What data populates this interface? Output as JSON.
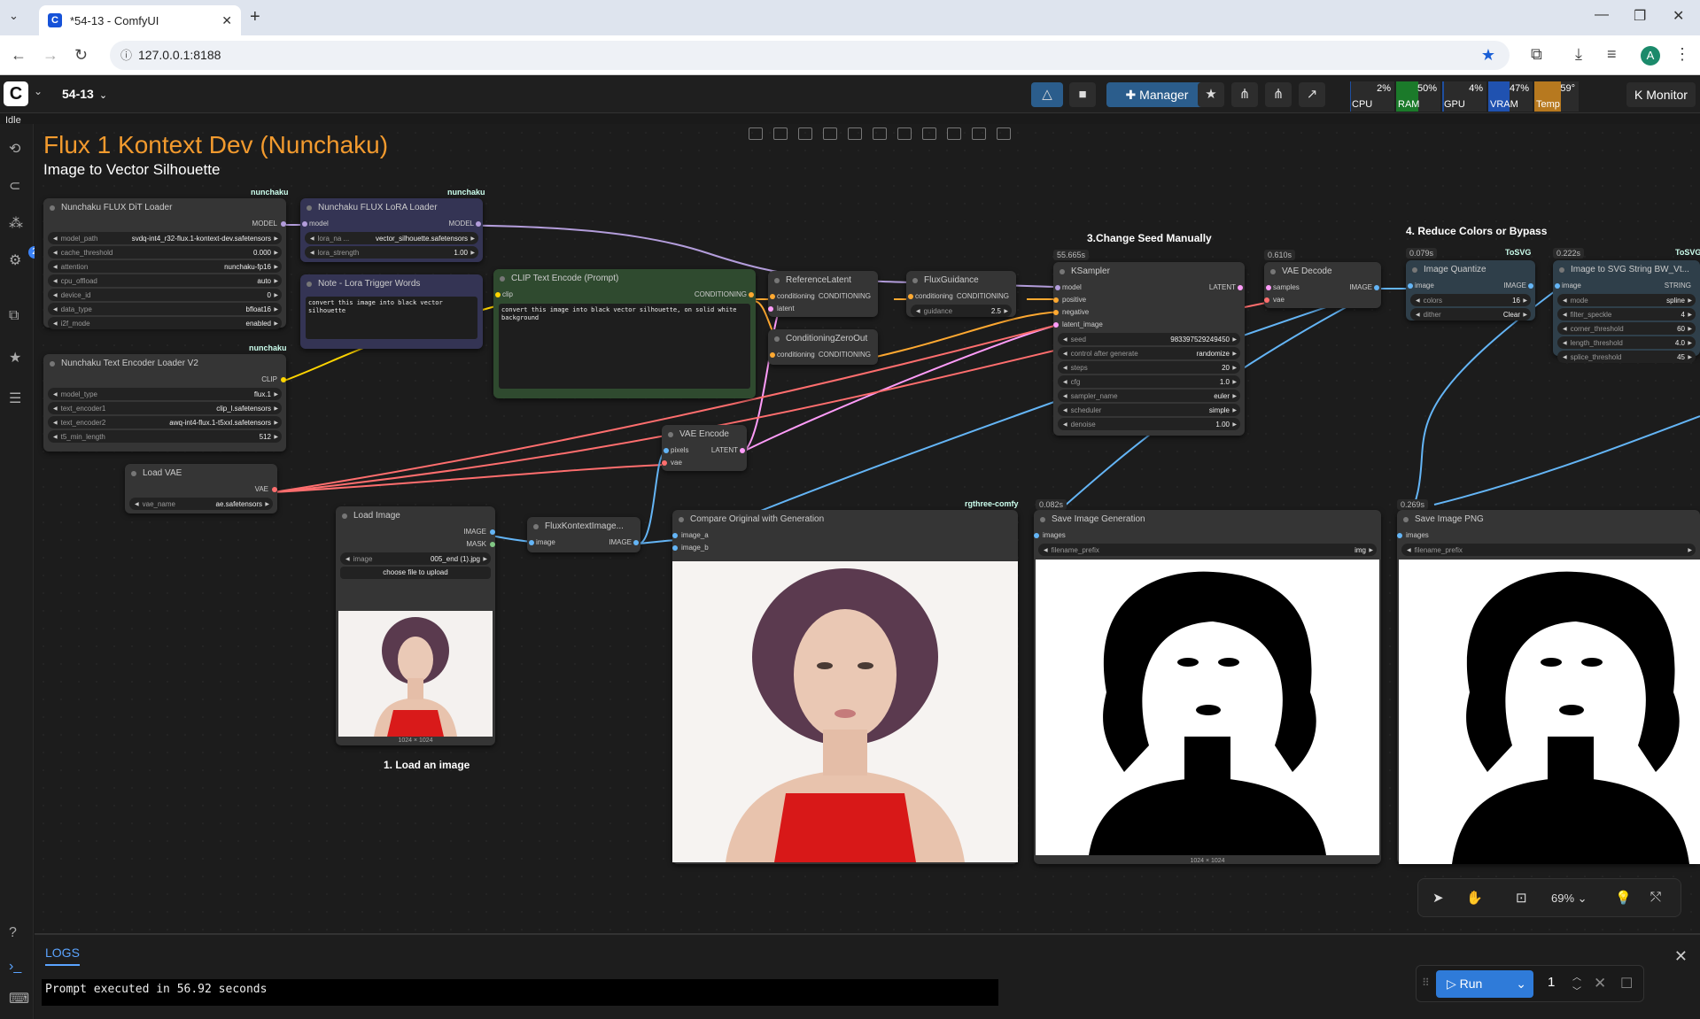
{
  "browser": {
    "tab_title": "*54-13 - ComfyUI",
    "url": "127.0.0.1:8188"
  },
  "app": {
    "workflow_name": "54-13",
    "status": "Idle",
    "manager_label": "Manager",
    "monitor_label": "Monitor",
    "monitors": [
      {
        "label": "CPU",
        "pct": "2%",
        "value": 0.02,
        "color": "#1f4fa0"
      },
      {
        "label": "RAM",
        "pct": "50%",
        "value": 0.5,
        "color": "#1b7a2a"
      },
      {
        "label": "GPU",
        "pct": "4%",
        "value": 0.04,
        "color": "#1f4fa0"
      },
      {
        "label": "VRAM",
        "pct": "47%",
        "value": 0.47,
        "color": "#2052b0"
      },
      {
        "label": "Temp",
        "pct": "59°",
        "value": 0.59,
        "color": "#b7791f"
      }
    ]
  },
  "canvas": {
    "title": "Flux 1 Kontext Dev (Nunchaku)",
    "subtitle": "Image to Vector Silhouette",
    "group_labels": {
      "step1": "1. Load an image",
      "step3": "3.Change Seed Manually",
      "step4": "4. Reduce Colors or Bypass"
    }
  },
  "nodes": {
    "dit": {
      "title": "Nunchaku FLUX DiT Loader",
      "tag": "nunchaku",
      "out": "MODEL",
      "widgets": [
        {
          "k": "model_path",
          "v": "svdq-int4_r32-flux.1-kontext-dev.safetensors"
        },
        {
          "k": "cache_threshold",
          "v": "0.000"
        },
        {
          "k": "attention",
          "v": "nunchaku-fp16"
        },
        {
          "k": "cpu_offload",
          "v": "auto"
        },
        {
          "k": "device_id",
          "v": "0"
        },
        {
          "k": "data_type",
          "v": "bfloat16"
        },
        {
          "k": "i2f_mode",
          "v": "enabled"
        }
      ]
    },
    "lora": {
      "title": "Nunchaku FLUX LoRA Loader",
      "tag": "nunchaku",
      "in": "model",
      "out": "MODEL",
      "widgets": [
        {
          "k": "lora_na ...",
          "v": "vector_silhouette.safetensors"
        },
        {
          "k": "lora_strength",
          "v": "1.00"
        }
      ]
    },
    "note": {
      "title": "Note - Lora Trigger Words",
      "text": "convert this image into black vector silhouette"
    },
    "te": {
      "title": "Nunchaku Text Encoder Loader V2",
      "tag": "nunchaku",
      "out": "CLIP",
      "widgets": [
        {
          "k": "model_type",
          "v": "flux.1"
        },
        {
          "k": "text_encoder1",
          "v": "clip_l.safetensors"
        },
        {
          "k": "text_encoder2",
          "v": "awq-int4-flux.1-t5xxl.safetensors"
        },
        {
          "k": "t5_min_length",
          "v": "512"
        }
      ]
    },
    "clip": {
      "title": "CLIP Text Encode (Prompt)",
      "in": "clip",
      "out": "CONDITIONING",
      "text": "convert this image into black vector silhouette, on solid white background"
    },
    "ref": {
      "title": "ReferenceLatent",
      "in1": "conditioning",
      "in2": "latent",
      "out": "CONDITIONING"
    },
    "zero": {
      "title": "ConditioningZeroOut",
      "in": "conditioning",
      "out": "CONDITIONING"
    },
    "guid": {
      "title": "FluxGuidance",
      "in": "conditioning",
      "out": "CONDITIONING",
      "widgets": [
        {
          "k": "guidance",
          "v": "2.5"
        }
      ]
    },
    "ks": {
      "title": "KSampler",
      "timer": "55.665s",
      "out": "LATENT",
      "ins": [
        "model",
        "positive",
        "negative",
        "latent_image"
      ],
      "widgets": [
        {
          "k": "seed",
          "v": "983397529249450"
        },
        {
          "k": "control after generate",
          "v": "randomize"
        },
        {
          "k": "steps",
          "v": "20"
        },
        {
          "k": "cfg",
          "v": "1.0"
        },
        {
          "k": "sampler_name",
          "v": "euler"
        },
        {
          "k": "scheduler",
          "v": "simple"
        },
        {
          "k": "denoise",
          "v": "1.00"
        }
      ]
    },
    "vaed": {
      "title": "VAE Decode",
      "timer": "0.610s",
      "ins": [
        "samples",
        "vae"
      ],
      "out": "IMAGE"
    },
    "quant": {
      "title": "Image Quantize",
      "timer": "0.079s",
      "tag": "ToSVG",
      "in": "image",
      "out": "IMAGE",
      "widgets": [
        {
          "k": "colors",
          "v": "16"
        },
        {
          "k": "dither",
          "v": "Clear"
        }
      ]
    },
    "svg": {
      "title": "Image to SVG String BW_Vt...",
      "timer": "0.222s",
      "tag": "ToSVG",
      "in": "image",
      "out": "STRING",
      "widgets": [
        {
          "k": "mode",
          "v": "spline"
        },
        {
          "k": "filter_speckle",
          "v": "4"
        },
        {
          "k": "corner_threshold",
          "v": "60"
        },
        {
          "k": "length_threshold",
          "v": "4.0"
        },
        {
          "k": "splice_threshold",
          "v": "45"
        }
      ]
    },
    "loadvae": {
      "title": "Load VAE",
      "out": "VAE",
      "widgets": [
        {
          "k": "vae_name",
          "v": "ae.safetensors"
        }
      ]
    },
    "loadimg": {
      "title": "Load Image",
      "outs": [
        "IMAGE",
        "MASK"
      ],
      "widgets": [
        {
          "k": "image",
          "v": "005_end (1).jpg"
        }
      ],
      "upload": "choose file to upload",
      "size": "1024 × 1024"
    },
    "fk": {
      "title": "FluxKontextImage...",
      "in": "image",
      "out": "IMAGE"
    },
    "vaee": {
      "title": "VAE Encode",
      "ins": [
        "pixels",
        "vae"
      ],
      "out": "LATENT"
    },
    "cmp": {
      "title": "Compare Original with Generation",
      "tag": "rgthree-comfy",
      "ins": [
        "image_a",
        "image_b"
      ]
    },
    "save": {
      "title": "Save Image Generation",
      "timer": "0.082s",
      "in": "images",
      "widget": {
        "k": "filename_prefix",
        "v": "img"
      },
      "size": "1024 × 1024"
    },
    "savepng": {
      "title": "Save Image PNG",
      "timer": "0.269s",
      "in": "images",
      "widget": {
        "k": "filename_prefix",
        "v": ""
      }
    }
  },
  "controls": {
    "zoom": "69%"
  },
  "logs": {
    "tab": "LOGS",
    "text": "Prompt executed in 56.92 seconds"
  },
  "run": {
    "label": "Run",
    "count": "1"
  },
  "colors": {
    "model": "#b39ddb",
    "clip": "#ffd500",
    "conditioning": "#ffa931",
    "latent": "#ff9cf9",
    "vae": "#ff6e6e",
    "image": "#64b5f6"
  }
}
